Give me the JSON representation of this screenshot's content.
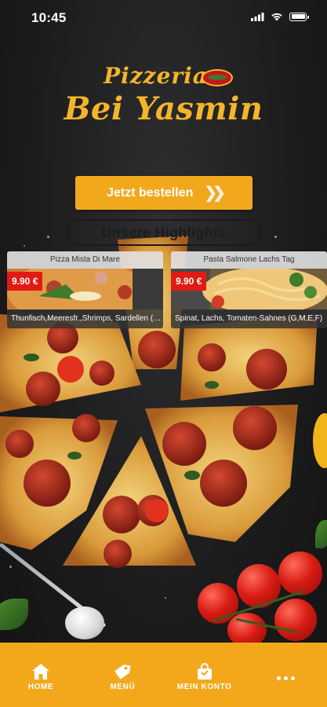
{
  "status_bar": {
    "time": "10:45"
  },
  "logo": {
    "line1": "Pizzeria",
    "line2": "Bei Yasmin"
  },
  "order_button": {
    "label": "Jetzt bestellen",
    "icon": "double-chevron-right-icon"
  },
  "highlights": {
    "title": "Unsere Highlights",
    "items": [
      {
        "name": "Pizza Mista Di Mare",
        "price": "9.90 €",
        "description": "Thunfisch,Meeresfr.,Shrimps, Sardellen (G..."
      },
      {
        "name": "Pasta Salmone Lachs Tag",
        "price": "9.90 €",
        "description": "Spinat, Lachs, Tomaten-Sahnes (G,M,E,F)"
      }
    ]
  },
  "bottom_nav": {
    "items": [
      {
        "label": "HOME",
        "icon": "home-icon"
      },
      {
        "label": "MENÜ",
        "icon": "tag-icon"
      },
      {
        "label": "MEIN KONTO",
        "icon": "shopping-bag-icon"
      },
      {
        "label": "",
        "icon": "more-dots-icon"
      }
    ]
  },
  "colors": {
    "accent": "#f3a81c",
    "price": "#e11b14",
    "logo": "#f5b52a",
    "background": "#1f1f20"
  }
}
